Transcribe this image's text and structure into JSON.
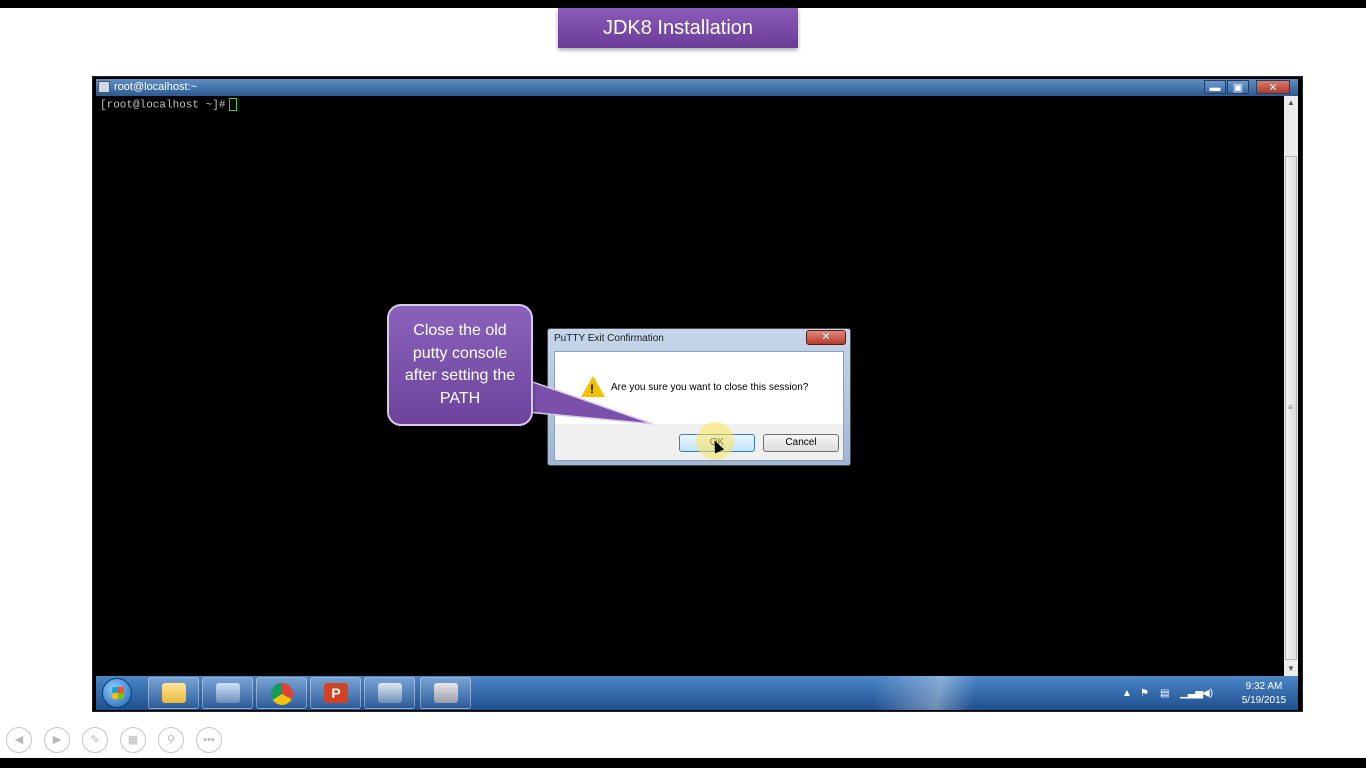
{
  "slide": {
    "title": "JDK8 Installation"
  },
  "putty_window": {
    "title": "root@localhost:~",
    "controls": {
      "minimize": "▬",
      "maximize": "▣",
      "close": "✕"
    }
  },
  "terminal": {
    "prompt": "[root@localhost ~]#"
  },
  "dialog": {
    "title": "PuTTY Exit Confirmation",
    "close_glyph": "✕",
    "message": "Are you sure you want to close this session?",
    "ok_label": "OK",
    "cancel_label": "Cancel",
    "icon": "warning-icon"
  },
  "callout": {
    "text": "Close the old putty console after setting the PATH"
  },
  "taskbar": {
    "items": [
      "windows-explorer",
      "text-editor",
      "chrome",
      "powerpoint",
      "network-tool",
      "putty"
    ],
    "clock": {
      "time": "9:32 AM",
      "date": "5/19/2015"
    }
  },
  "nav_controls": [
    "previous",
    "next",
    "pen",
    "slides",
    "zoom",
    "more"
  ],
  "colors": {
    "title_purple": "#7a4caa",
    "terminal_bg": "#000000",
    "taskbar_blue": "#2f67a8",
    "cursor_green": "#3ed13e"
  }
}
